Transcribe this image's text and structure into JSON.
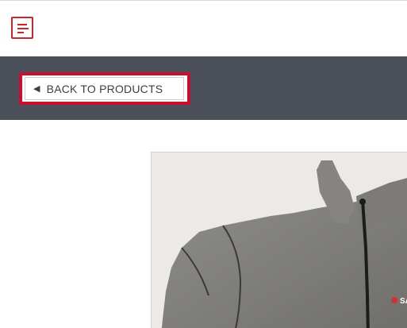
{
  "header": {
    "menu_icon": "hamburger-menu-icon",
    "accent_color": "#c62828"
  },
  "nav": {
    "back_arrow_icon": "triangle-left-icon",
    "back_label": "BACK TO PRODUCTS",
    "highlight_color": "#c8102e",
    "band_color": "#4a4f59"
  },
  "product": {
    "image_subject": "gray-zip-jacket",
    "logo_text": "SA"
  }
}
